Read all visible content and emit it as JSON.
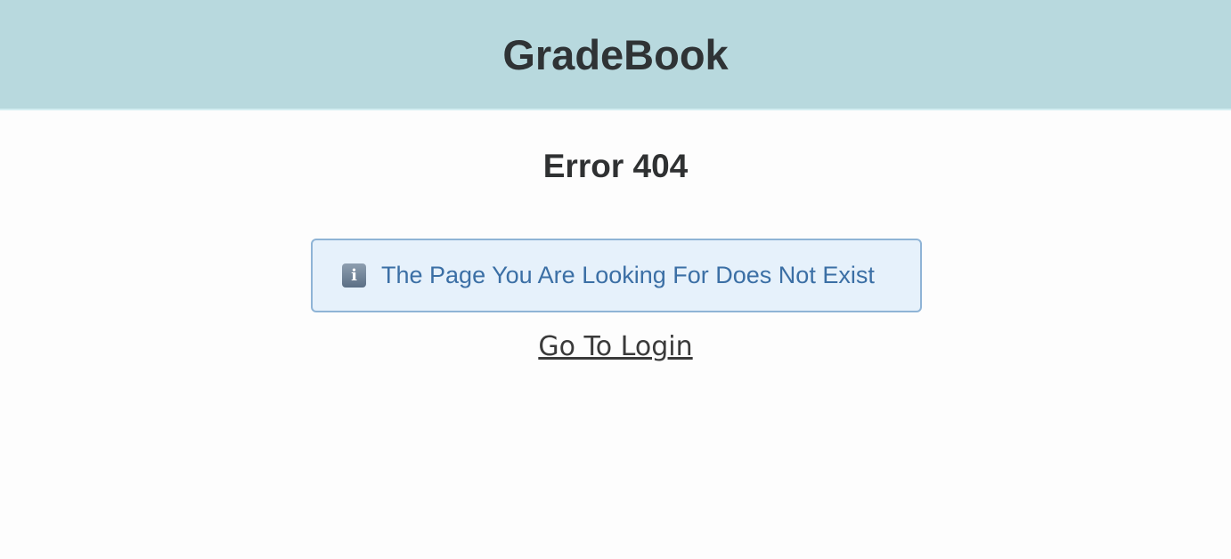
{
  "header": {
    "app_title": "GradeBook"
  },
  "main": {
    "error_title": "Error 404",
    "alert": {
      "icon": "info-icon",
      "icon_glyph": "i",
      "message": "The Page You Are Looking For Does Not Exist"
    },
    "login_link": "Go To Login"
  },
  "colors": {
    "header_bg": "#b8d9de",
    "alert_bg": "#e6f1fb",
    "alert_border": "#8fb4d6",
    "alert_text": "#3b6fa5",
    "title_text": "#2f3335"
  }
}
